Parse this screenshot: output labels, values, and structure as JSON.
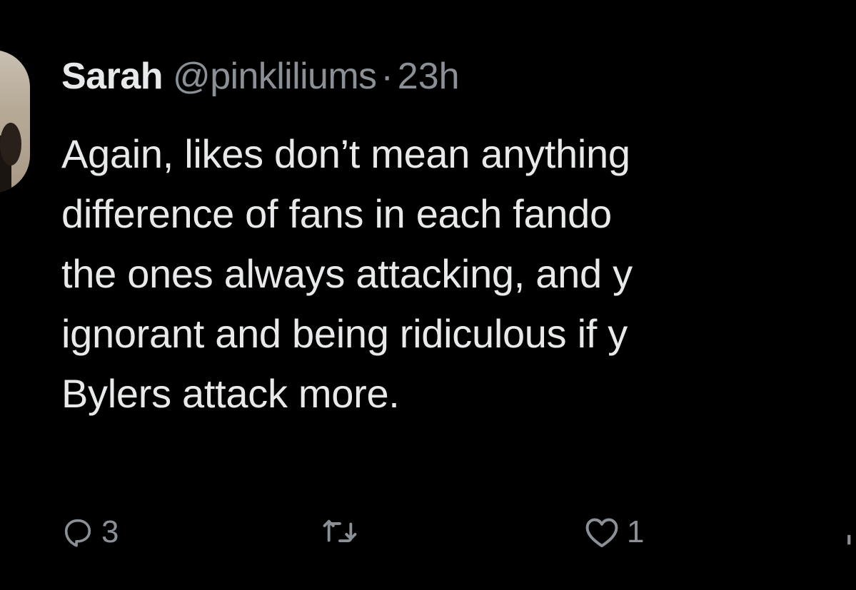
{
  "tweet": {
    "author_name": "Sarah",
    "handle": "@pinkliliums",
    "separator": "·",
    "time": "23h",
    "lines": [
      "Again, likes don’t mean anything",
      "difference of fans in each fando",
      "the ones always attacking, and y",
      "ignorant and being ridiculous if y",
      "Bylers attack more."
    ]
  },
  "actions": {
    "reply_count": "3",
    "retweet_count": "",
    "like_count": "1"
  },
  "icons": {
    "reply": "speech-bubble-icon",
    "retweet": "retweet-arrows-icon",
    "like": "heart-outline-icon",
    "share": "share-icon"
  },
  "colors": {
    "background": "#000000",
    "primary_text": "#e7e9ea",
    "secondary_text": "#8b9096"
  }
}
